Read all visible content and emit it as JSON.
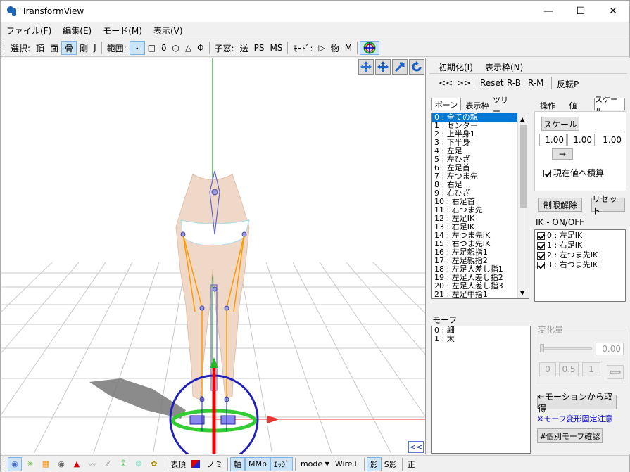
{
  "window": {
    "title": "TransformView",
    "minimize": "—",
    "maximize": "☐",
    "close": "✕"
  },
  "menu": [
    "ファイル(F)",
    "編集(E)",
    "モード(M)",
    "表示(V)"
  ],
  "toolbar": {
    "select_label": "選択:",
    "select_items": [
      "頂",
      "面",
      "骨",
      "剛",
      "J"
    ],
    "range_label": "範囲:",
    "range_items": [
      "・",
      "□",
      "δ",
      "○",
      "△",
      "Φ"
    ],
    "child_label": "子窓:",
    "child_items": [
      "送",
      "PS",
      "MS"
    ],
    "mode_label": "ﾓｰﾄﾞ:",
    "mode_items": [
      "▷",
      "物",
      "M"
    ]
  },
  "viewport": {
    "collapse_button": "<<"
  },
  "panel": {
    "init_menu": "初期化(I)",
    "display_menu": "表示枠(N)",
    "nav_prev": "<<",
    "nav_next": ">>",
    "reset": "Reset",
    "rb": "R-B",
    "rm": "R-M",
    "flip": "反転P",
    "left_tabs": [
      "ボーン",
      "表示枠",
      "ツリー"
    ],
    "right_tabs": [
      "操作",
      "値",
      "スケール"
    ],
    "bones": [
      "0 : 全ての親",
      "1 : センター",
      "2 : 上半身1",
      "3 : 下半身",
      "4 : 左足",
      "5 : 左ひざ",
      "6 : 左足首",
      "7 : 左つま先",
      "8 : 右足",
      "9 : 右ひざ",
      "10 : 右足首",
      "11 : 右つま先",
      "12 : 左足IK",
      "13 : 右足IK",
      "14 : 左つま先IK",
      "15 : 右つま先IK",
      "16 : 左足親指1",
      "17 : 左足親指2",
      "18 : 左足人差し指1",
      "19 : 左足人差し指2",
      "20 : 左足人差し指3",
      "21 : 左足中指1"
    ],
    "scale_button": "スケール",
    "scale_values": [
      "1.00",
      "1.00",
      "1.00"
    ],
    "arrow_button": "→",
    "accumulate_label": "現在値へ積算",
    "unlimit_button": "制限解除",
    "reset_button": "リセット",
    "ik_label": "IK - ON/OFF",
    "ik_items": [
      "0 : 左足IK",
      "1 : 右足IK",
      "2 : 左つま先IK",
      "3 : 右つま先IK"
    ],
    "morph_label": "モーフ",
    "morphs": [
      "0 : 細",
      "1 : 太"
    ],
    "change_label": "変化量",
    "change_value": "0.00",
    "quick_values": [
      "0",
      "0.5",
      "1"
    ],
    "get_from_motion": "←モーションから取得",
    "morph_note": "※モーフ変形固定注意",
    "individual_morph": "#個別モーフ確認"
  },
  "bottombar": {
    "table_label": "表頂",
    "no_label": "ノミ",
    "axis_label": "軸",
    "mb_label": "MMb",
    "edge_label": "ｴｯｼﾞ",
    "mode_label": "mode",
    "wire_label": "Wire+",
    "shadow_label": "影",
    "sshadow_label": "S影",
    "correct_label": "正"
  },
  "colors": {
    "accent": "#0078d7",
    "axis_red": "#ff0000",
    "axis_green": "#00a000",
    "ring_blue": "#0000cc",
    "ring_green": "#22cc22"
  }
}
